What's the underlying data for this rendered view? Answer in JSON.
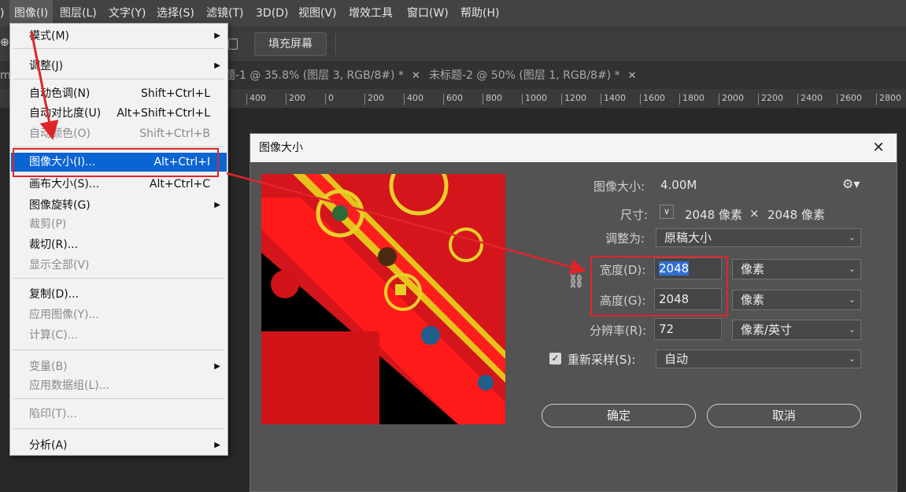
{
  "menubar": {
    "items": [
      {
        "label": ")"
      },
      {
        "label": "图像(I)"
      },
      {
        "label": "图层(L)"
      },
      {
        "label": "文字(Y)"
      },
      {
        "label": "选择(S)"
      },
      {
        "label": "滤镜(T)"
      },
      {
        "label": "3D(D)"
      },
      {
        "label": "视图(V)"
      },
      {
        "label": "增效工具"
      },
      {
        "label": "窗口(W)"
      },
      {
        "label": "帮助(H)"
      }
    ]
  },
  "options": {
    "fill_button": "填充屏幕"
  },
  "tabs": [
    {
      "label": "mb"
    },
    {
      "label": "题-1 @ 35.8% (图层 3, RGB/8#) *"
    },
    {
      "label": "未标题-2 @ 50% (图层 1, RGB/8#) *"
    }
  ],
  "ruler": {
    "ticks": [
      "400",
      "200",
      "0",
      "200",
      "400",
      "600",
      "800",
      "1000",
      "1200",
      "1400",
      "1600",
      "1800",
      "2000",
      "2200",
      "2400",
      "2600",
      "2800"
    ]
  },
  "menu": {
    "items": [
      {
        "label": "模式(M)",
        "shortcut": "",
        "submenu": true
      },
      {
        "label": "调整(J)",
        "shortcut": "",
        "submenu": true
      },
      {
        "label": "自动色调(N)",
        "shortcut": "Shift+Ctrl+L"
      },
      {
        "label": "自动对比度(U)",
        "shortcut": "Alt+Shift+Ctrl+L"
      },
      {
        "label": "自动颜色(O)",
        "shortcut": "Shift+Ctrl+B"
      },
      {
        "label": "图像大小(I)...",
        "shortcut": "Alt+Ctrl+I"
      },
      {
        "label": "画布大小(S)...",
        "shortcut": "Alt+Ctrl+C"
      },
      {
        "label": "图像旋转(G)",
        "shortcut": "",
        "submenu": true
      },
      {
        "label": "裁剪(P)",
        "shortcut": ""
      },
      {
        "label": "裁切(R)...",
        "shortcut": ""
      },
      {
        "label": "显示全部(V)",
        "shortcut": ""
      },
      {
        "label": "复制(D)...",
        "shortcut": ""
      },
      {
        "label": "应用图像(Y)...",
        "shortcut": ""
      },
      {
        "label": "计算(C)...",
        "shortcut": ""
      },
      {
        "label": "变量(B)",
        "shortcut": "",
        "submenu": true
      },
      {
        "label": "应用数据组(L)...",
        "shortcut": ""
      },
      {
        "label": "陷印(T)...",
        "shortcut": ""
      },
      {
        "label": "分析(A)",
        "shortcut": "",
        "submenu": true
      }
    ]
  },
  "dialog": {
    "title": "图像大小",
    "close": "✕",
    "image_size_label": "图像大小:",
    "image_size_value": "4.00M",
    "dimensions_label": "尺寸:",
    "dimensions_width": "2048 像素",
    "dimensions_times": "×",
    "dimensions_height": "2048 像素",
    "fit_to_label": "调整为:",
    "fit_to_value": "原稿大小",
    "width_label": "宽度(D):",
    "width_value": "2048",
    "width_unit": "像素",
    "height_label": "高度(G):",
    "height_value": "2048",
    "height_unit": "像素",
    "resolution_label": "分辨率(R):",
    "resolution_value": "72",
    "resolution_unit": "像素/英寸",
    "resample_label": "重新采样(S):",
    "resample_value": "自动",
    "resample_checked": true,
    "ok_button": "确定",
    "cancel_button": "取消"
  },
  "annotation_color": "#e0252a",
  "highlight_color": "#0a64d2"
}
